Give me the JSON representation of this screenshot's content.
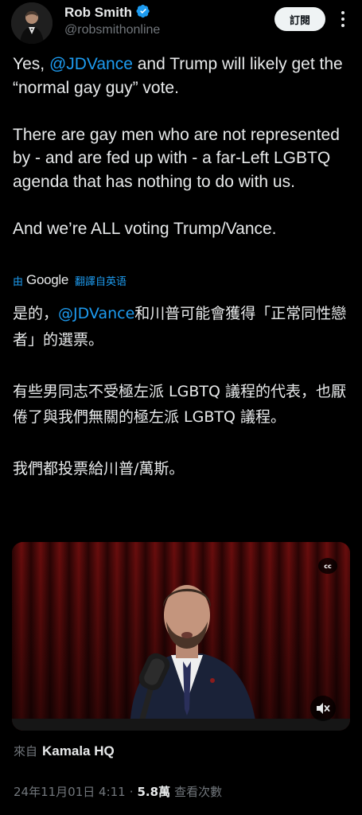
{
  "author": {
    "display_name": "Rob Smith",
    "handle": "@robsmithonline",
    "verified": true,
    "verified_color": "#1d9bf0"
  },
  "actions": {
    "follow_label": "訂閱",
    "more_icon": "more-icon"
  },
  "tweet": {
    "line1_pre": "Yes, ",
    "line1_mention": "@JDVance",
    "line1_post": " and Trump will likely get the “normal gay guy” vote.",
    "para2": "There are gay men who are not represented by - and are fed up with - a far-Left LGBTQ agenda that has nothing to do with us.",
    "para3": "And we’re ALL voting Trump/Vance."
  },
  "translation": {
    "by_label": "由",
    "provider": "Google",
    "translate_label": "翻譯自英语",
    "line1_pre": "是的，",
    "line1_mention": "@JDVance",
    "line1_post": "和川普可能會獲得「正常同性戀者」的選票。",
    "para2": "有些男同志不受極左派 LGBTQ 議程的代表，也厭倦了與我們無關的極左派 LGBTQ 議程。",
    "para3": "我們都投票給川普/萬斯。"
  },
  "media": {
    "cc_label": "cc",
    "mute_icon": "volume-mute-icon"
  },
  "source": {
    "prefix": "來自",
    "name": "Kamala HQ"
  },
  "meta": {
    "timestamp": "24年11月01日 4:11",
    "separator": "·",
    "views_count": "5.8萬",
    "views_label": "查看次數"
  },
  "colors": {
    "background": "#000000",
    "text": "#e7e9ea",
    "secondary": "#71767b",
    "accent": "#1d9bf0"
  }
}
